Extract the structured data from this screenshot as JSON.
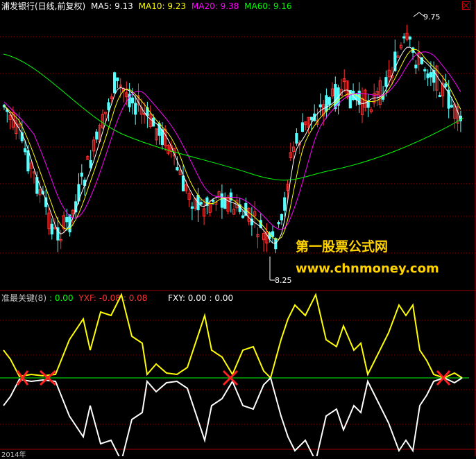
{
  "main_header": {
    "title": "浦发银行(日线,前复权)",
    "ma5": "MA5: 9.13",
    "ma10": "MA10: 9.23",
    "ma20": "MA20: 9.38",
    "ma60": "MA60: 9.16"
  },
  "indicator_header": {
    "name": "准最关键(8)",
    "v1": ": 0.00",
    "yxf": "YXF: -0.08",
    "yxf2": ": 0.08",
    "fxy": "FXY: 0.00",
    "fxy2": ": 0.00"
  },
  "price_labels": {
    "high": "9.75",
    "low": "8.25"
  },
  "watermark": {
    "line1": "第一股票公式网",
    "line2": "www.chnmoney.com"
  },
  "bottom_axis": {
    "year_label": "2014年"
  },
  "colors": {
    "background": "#000000",
    "up_candle": "#ff3232",
    "down_candle": "#54ffff",
    "ma5": "#ffffff",
    "ma10": "#ffff00",
    "ma20": "#ff00ff",
    "ma60": "#00ff00",
    "watermark": "#ffd200",
    "grid": "#8b0000"
  },
  "icons": {
    "close": "close-icon"
  }
}
